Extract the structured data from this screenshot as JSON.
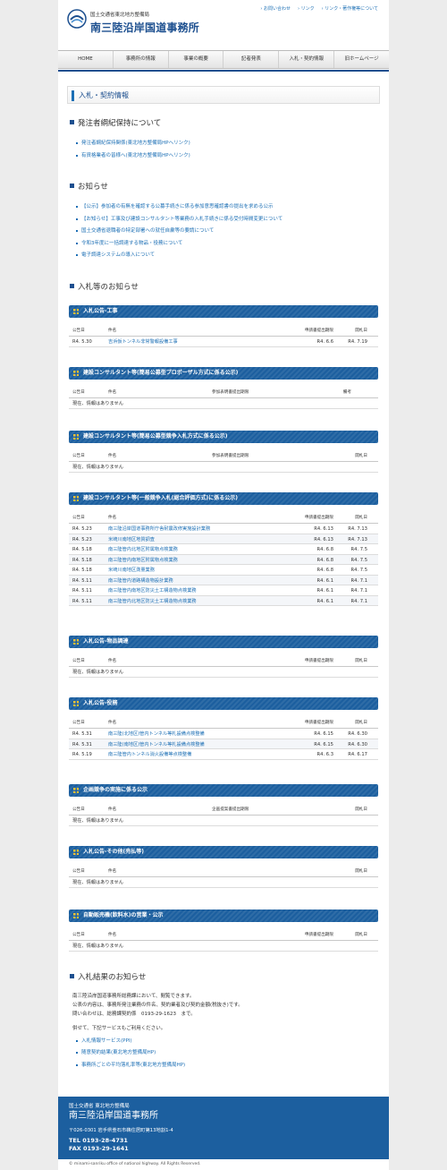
{
  "header": {
    "org": "国土交通省東北地方整備局",
    "office": "南三陸沿岸国道事務所",
    "links": [
      "お問い合わせ",
      "リンク",
      "リンク・著作権等について"
    ]
  },
  "nav": [
    "HOME",
    "事務所の情報",
    "事業の概要",
    "記者発表",
    "入札・契約情報",
    "旧ホームページ"
  ],
  "page_title": "入札・契約情報",
  "discipline": {
    "heading": "発注者綱紀保持について",
    "items": [
      "発注者綱紀保持関係(東北地方整備局HPへリンク)",
      "有資格業者の皆様へ(東北地方整備局HPへリンク)"
    ]
  },
  "notices": {
    "heading": "お知らせ",
    "items": [
      "【公示】参加者の有無を確認する公募手続きに係る参加意思確認書の提出を求める公示",
      "【お知らせ】工事及び建設コンサルタント等業務の入札手続きに係る受付時間変更について",
      "国土交通省退職者の特定部署への就任自粛等の要請について",
      "令和3年度に一括調達する物品・役務について",
      "電子調達システムの導入について"
    ]
  },
  "bids_heading": "入札等のお知らせ",
  "no_info": "現在、情報はありません",
  "sections": [
    {
      "title": "入札公告-工事",
      "headers": [
        "公告日",
        "件名",
        "申請書提出期限",
        "開札日"
      ],
      "rows": [
        [
          "R4. 5.30",
          "吉浜仮トンネル非常警報設備工事",
          "R4. 6.6",
          "R4. 7.19"
        ]
      ]
    },
    {
      "title": "建設コンサルタント等(簡易公募型プロポーザル方式に係る公示)",
      "headers": [
        "公告日",
        "件名",
        "参加表明書提出期限",
        "備考"
      ],
      "rows": []
    },
    {
      "title": "建設コンサルタント等(簡易公募型競争入札方式に係る公示)",
      "headers": [
        "公告日",
        "件名",
        "参加表明書提出期限",
        "開札日"
      ],
      "rows": []
    },
    {
      "title": "建設コンサルタント等(一般競争入札(総合評価方式)に係る公示)",
      "headers": [
        "公告日",
        "件名",
        "申請書提出期限",
        "開札日"
      ],
      "rows": [
        [
          "R4. 5.23",
          "南三陸沿岸国道事務所庁舎耐震改修実施設計業務",
          "R4. 6.13",
          "R4. 7.13"
        ],
        [
          "R4. 5.23",
          "米崎川南地区地質調査",
          "R4. 6.13",
          "R4. 7.13"
        ],
        [
          "R4. 5.18",
          "南三陸管内北地区附属物点検業務",
          "R4. 6.8",
          "R4. 7.5"
        ],
        [
          "R4. 5.18",
          "南三陸管内南地区附属物点検業務",
          "R4. 6.8",
          "R4. 7.5"
        ],
        [
          "R4. 5.18",
          "米崎川南地区測量業務",
          "R4. 6.8",
          "R4. 7.5"
        ],
        [
          "R4. 5.11",
          "南三陸管内道路構造物設計業務",
          "R4. 6.1",
          "R4. 7.1"
        ],
        [
          "R4. 5.11",
          "南三陸管内南地区防災土工構造物点検業務",
          "R4. 6.1",
          "R4. 7.1"
        ],
        [
          "R4. 5.11",
          "南三陸管内北地区防災土工構造物点検業務",
          "R4. 6.1",
          "R4. 7.1"
        ]
      ]
    },
    {
      "title": "入札公告-物品調達",
      "headers": [
        "公告日",
        "件名",
        "申請書提出期限",
        "開札日"
      ],
      "rows": []
    },
    {
      "title": "入札公告-役務",
      "headers": [
        "公告日",
        "件名",
        "申請書提出期限",
        "開札日"
      ],
      "rows": [
        [
          "R4. 5.31",
          "南三陸(北地区)管内トンネル等札設備点検整備",
          "R4. 6.15",
          "R4. 6.30"
        ],
        [
          "R4. 5.31",
          "南三陸(南地区)管内トンネル等札設備点検整備",
          "R4. 6.15",
          "R4. 6.30"
        ],
        [
          "R4. 5.19",
          "南三陸管内トンネル消火設備等点検整備",
          "R4. 6.3",
          "R4. 6.17"
        ]
      ]
    },
    {
      "title": "企画競争の実施に係る公示",
      "headers": [
        "公告日",
        "件名",
        "企画提案書提出期限",
        "開札日"
      ],
      "rows": []
    },
    {
      "title": "入札公告-その他(売払等)",
      "headers": [
        "公告日",
        "件名",
        "",
        "開札日"
      ],
      "rows": []
    },
    {
      "title": "自動販売機(飲料水)の営業・公示",
      "headers": [
        "公告日",
        "件名",
        "申請書提出期限",
        "開札日"
      ],
      "rows": []
    }
  ],
  "results": {
    "heading": "入札結果のお知らせ",
    "p1": "南三陸沿岸国道事務所総務課において、閲覧できます。",
    "p2": "公表の内容は、事務所発注業務の件名、契約業者及び契約金額(税抜き)です。",
    "p3": "問い合わせは、総務課契約係　0193-29-1623　まで。",
    "p4": "併せて、下記サービスもご利用ください。",
    "links": [
      "入札情報サービス(PPI)",
      "随意契約結果(東北地方整備局HP)",
      "事務所ごとの平均落札率等(東北地方整備局HP)"
    ]
  },
  "footer": {
    "org": "国土交通省 東北地方整備局",
    "office": "南三陸沿岸国道事務所",
    "address": "〒026-0301 岩手県釜石市鵜住居町第13地割1-4",
    "tel": "TEL 0193-28-4731",
    "fax": "FAX 0193-29-1641",
    "copyright": "© minami-sanriku office of national highway. All Rights Reserved."
  },
  "colors": {
    "brand": "#1c4f8f",
    "section_bar": "#1c5f9f",
    "link": "#1c6fb5",
    "icon_accent": "#f2c233"
  }
}
